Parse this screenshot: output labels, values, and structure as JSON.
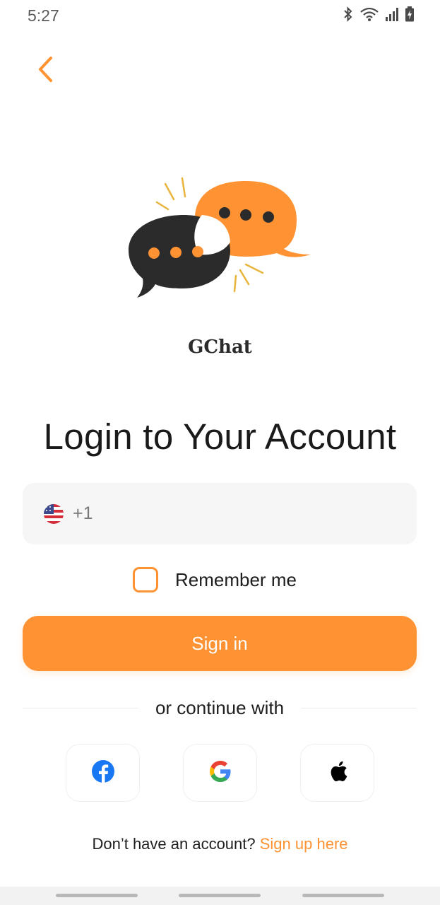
{
  "status_bar": {
    "time": "5:27",
    "icons": [
      "bluetooth-icon",
      "wifi-icon",
      "signal-icon",
      "battery-charging-icon"
    ]
  },
  "header": {
    "back_icon": "chevron-left-icon"
  },
  "brand": {
    "app_name": "GChat",
    "logo_icon": "chat-bubbles-logo"
  },
  "login": {
    "title": "Login to Your Account",
    "phone": {
      "country_flag": "us-flag-icon",
      "country_code": "+1",
      "value": "",
      "placeholder": ""
    },
    "remember_me": {
      "label": "Remember me",
      "checked": false
    },
    "signin_label": "Sign in",
    "divider_text": "or continue with",
    "social": [
      {
        "name": "Facebook",
        "icon": "facebook-icon"
      },
      {
        "name": "Google",
        "icon": "google-icon"
      },
      {
        "name": "Apple",
        "icon": "apple-icon"
      }
    ],
    "signup_prompt": "Don’t have an account?",
    "signup_link": "Sign up here"
  },
  "colors": {
    "accent": "#ff9232",
    "dark": "#2b2b2b",
    "field_bg": "#f6f6f7"
  }
}
